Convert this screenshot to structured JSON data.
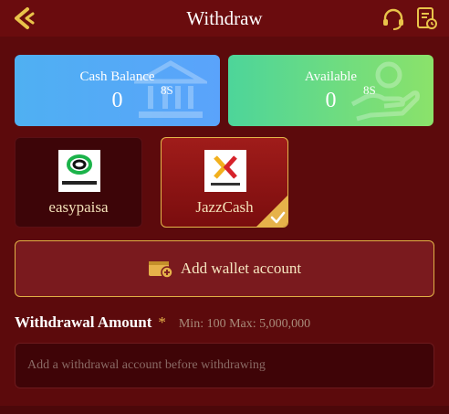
{
  "header": {
    "title": "Withdraw",
    "back_icon": "chevron-left-icon",
    "support_icon": "headset-icon",
    "record_icon": "record-list-icon"
  },
  "balances": {
    "cash": {
      "label": "Cash Balance",
      "value": "0",
      "unit": "8S",
      "icon": "bank-icon"
    },
    "available": {
      "label": "Available",
      "value": "0",
      "unit": "8S",
      "icon": "hand-money-icon"
    }
  },
  "methods": [
    {
      "name": "easypaisa",
      "selected": false
    },
    {
      "name": "JazzCash",
      "selected": true
    }
  ],
  "add_wallet": {
    "label": "Add wallet account",
    "icon": "wallet-add-icon"
  },
  "withdrawal": {
    "label": "Withdrawal Amount",
    "required_mark": "*",
    "range": "Min: 100 Max: 5,000,000",
    "placeholder": "Add a withdrawal account before withdrawing",
    "value": ""
  },
  "colors": {
    "background": "#5c0a0c",
    "accent_gold": "#e6b24a",
    "cash_card": "#4fb0f2",
    "available_card": "#4dd59a"
  }
}
